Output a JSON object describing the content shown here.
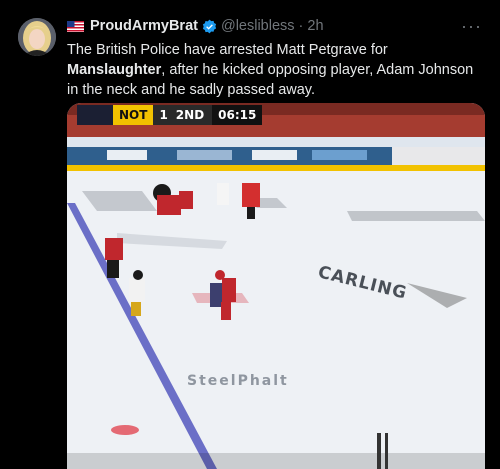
{
  "author": {
    "display_name": "ProudArmyBrat",
    "handle": "@leslibless",
    "separator": "·",
    "time": "2h",
    "flag_icon": "us-flag-icon",
    "verified_icon": "verified-badge-icon"
  },
  "tweet": {
    "text_part1": "The British Police have arrested Matt Petgrave for ",
    "text_bold": "Manslaughter",
    "text_part2": ", after he kicked opposing player, Adam Johnson in the neck and he sadly passed away."
  },
  "video": {
    "team": "NOT",
    "score": "1",
    "period": "2ND",
    "clock": "06:15",
    "ice_text_1": "CARLING",
    "ice_text_2": "SteelPhalt"
  },
  "colors": {
    "accent_blue": "#1d9bf0",
    "secondary_text": "#71767b"
  },
  "more_icon": "more-options-icon"
}
